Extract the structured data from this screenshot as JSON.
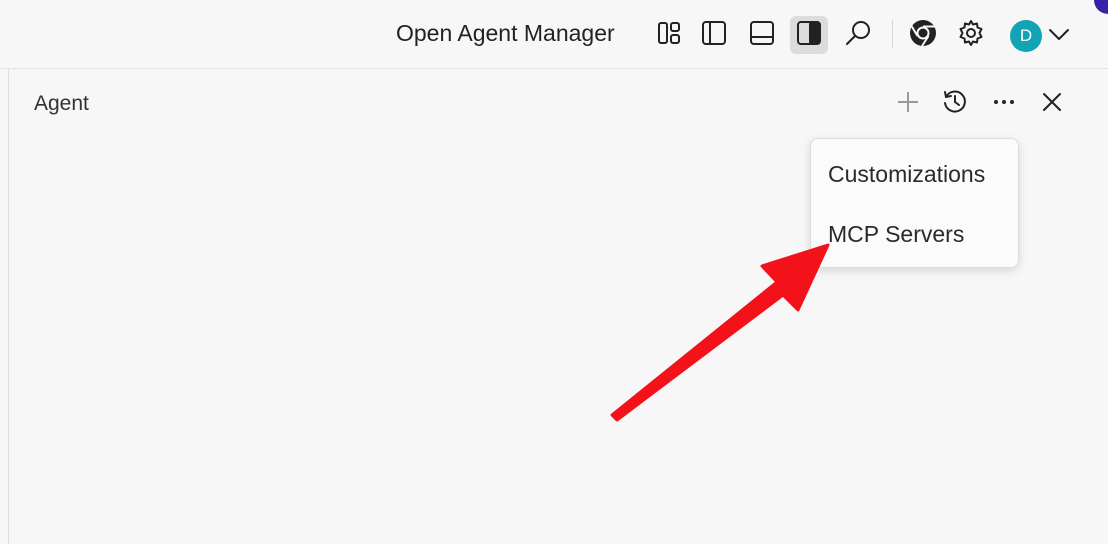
{
  "topbar": {
    "title": "Open Agent Manager",
    "icons": [
      "layout-grid-icon",
      "toggle-primary-sidebar-icon",
      "toggle-panel-icon",
      "toggle-secondary-sidebar-icon",
      "search-icon",
      "chrome-icon",
      "settings-gear-icon"
    ],
    "avatar_initial": "D",
    "avatar_color": "#12a3b4"
  },
  "panel": {
    "title": "Agent",
    "actions": [
      "new-chat-icon",
      "history-icon",
      "more-icon",
      "close-icon"
    ]
  },
  "menu": {
    "items": [
      "Customizations",
      "MCP Servers"
    ]
  },
  "annotation": {
    "arrow_color": "#f4121a"
  }
}
